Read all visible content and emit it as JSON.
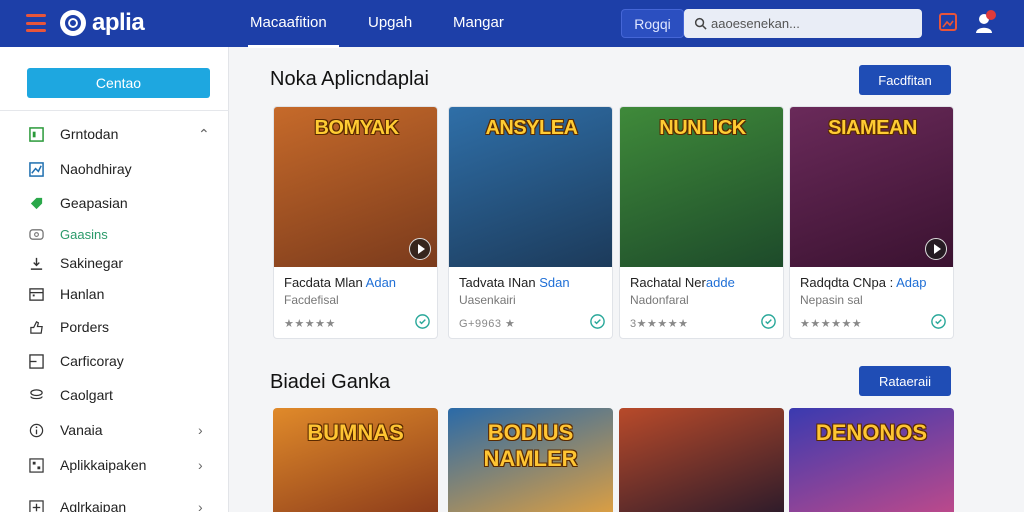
{
  "app": {
    "name": "aplia"
  },
  "nav": {
    "tabs": [
      {
        "label": "Macaafition",
        "active": true
      },
      {
        "label": "Upgah"
      },
      {
        "label": "Mangar"
      }
    ],
    "signin_label": "Rogqi",
    "search_placeholder": "aaoesenekan..."
  },
  "sidebar": {
    "create_label": "Centao",
    "items": [
      {
        "label": "Grntodan",
        "icon": "grid-icon",
        "chevron": "up"
      },
      {
        "label": "Naohdhiray",
        "icon": "chart-icon"
      },
      {
        "label": "Geapasian",
        "icon": "tag-icon"
      },
      {
        "label": "Gaasins",
        "icon": "ticket-icon"
      },
      {
        "label": "Sakinegar",
        "icon": "download-icon"
      },
      {
        "label": "Hanlan",
        "icon": "calendar-icon"
      },
      {
        "label": "Porders",
        "icon": "thumb-icon"
      },
      {
        "label": "Carficoray",
        "icon": "category-icon"
      },
      {
        "label": "Caolgart",
        "icon": "stack-icon"
      },
      {
        "label": "Vanaia",
        "icon": "info-icon",
        "chevron": "right"
      },
      {
        "label": "Aplikkaipaken",
        "icon": "apps-icon",
        "chevron": "right"
      },
      {
        "label": "Aglrkaipan",
        "icon": "plus-icon",
        "chevron": "right"
      }
    ]
  },
  "section1": {
    "title": "Noka Aplicndaplai",
    "button": "Facdfitan",
    "cards": [
      {
        "thumb_title": "BOMYAK",
        "title": "Facdata Mlan",
        "accent": "Adan",
        "subtitle": "Facdefisal",
        "rating": "★★★★★",
        "colors": [
          "#c66a2a",
          "#7a3a1c"
        ]
      },
      {
        "thumb_title": "ANSYLEA",
        "title": "Tadvata INan",
        "accent": "Sdan",
        "subtitle": "Uasenkairi",
        "rating": "G+9963 ★",
        "colors": [
          "#2f6fa8",
          "#1c3a5a"
        ]
      },
      {
        "thumb_title": "NUNLICK",
        "title": "Rachatal Ner",
        "accent": "adde",
        "subtitle": "Nadonfaral",
        "rating": "3★★★★★",
        "colors": [
          "#3f8a3a",
          "#1d4a2a"
        ]
      },
      {
        "thumb_title": "SIAMEAN",
        "title": "Radqdta CNpa :",
        "accent": "Adap",
        "subtitle": "Nepasin sal",
        "rating": "★★★★★★",
        "colors": [
          "#6a2a5a",
          "#3a1230"
        ]
      }
    ]
  },
  "section2": {
    "title": "Biadei Ganka",
    "button": "Rataeraii",
    "cards": [
      {
        "thumb_title": "BUMNAS",
        "colors": [
          "#e08a2a",
          "#8a3a1a"
        ]
      },
      {
        "thumb_title": "BODIUS NAMLER",
        "colors": [
          "#2a6aa8",
          "#e0a040"
        ]
      },
      {
        "thumb_title": "",
        "colors": [
          "#b84a2a",
          "#2a1a2a"
        ]
      },
      {
        "thumb_title": "DENONOS",
        "colors": [
          "#3a3ab0",
          "#c04a8a"
        ]
      }
    ]
  }
}
